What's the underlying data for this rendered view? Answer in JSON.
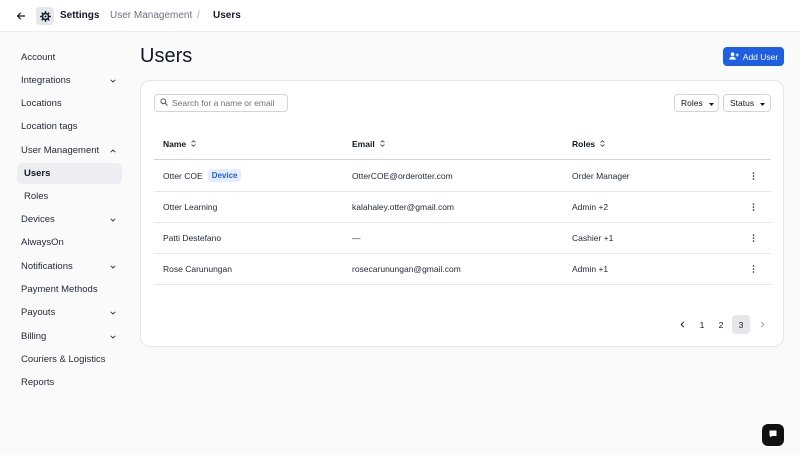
{
  "header": {
    "breadcrumb": [
      "Settings",
      "User Management",
      "/",
      "Users"
    ]
  },
  "sidebar": {
    "items": [
      {
        "label": "Account"
      },
      {
        "label": "Integrations"
      },
      {
        "label": "Locations"
      },
      {
        "label": "Location tags"
      },
      {
        "label": "User Management"
      },
      {
        "label": "Users"
      },
      {
        "label": "Roles"
      },
      {
        "label": "Devices"
      },
      {
        "label": "AlwaysOn"
      },
      {
        "label": "Notifications"
      },
      {
        "label": "Payment Methods"
      },
      {
        "label": "Payouts"
      },
      {
        "label": "Billing"
      },
      {
        "label": "Couriers & Logistics"
      },
      {
        "label": "Reports"
      }
    ]
  },
  "main": {
    "title": "Users",
    "add_user_label": "Add User",
    "search_placeholder": "Search for a name or email",
    "filters": {
      "roles": "Roles",
      "status": "Status"
    },
    "columns": [
      "Name",
      "Email",
      "Roles"
    ],
    "rows": [
      {
        "name": "Otter COE",
        "badge": "Device",
        "email": "OtterCOE@orderotter.com",
        "roles": "Order Manager"
      },
      {
        "name": "Otter Learning",
        "email": "kalahaley.otter@gmail.com",
        "roles": "Admin +2"
      },
      {
        "name": "Patti Destefano",
        "email": "—",
        "roles": "Cashier +1"
      },
      {
        "name": "Rose Carunungan",
        "email": "rosecarunungan@gmail.com",
        "roles": "Admin +1"
      }
    ],
    "pagination": {
      "pages": [
        "1",
        "2",
        "3"
      ],
      "current": "3"
    }
  },
  "colors": {
    "accent": "#1d5fe0",
    "badge_bg": "#e3edfc"
  }
}
